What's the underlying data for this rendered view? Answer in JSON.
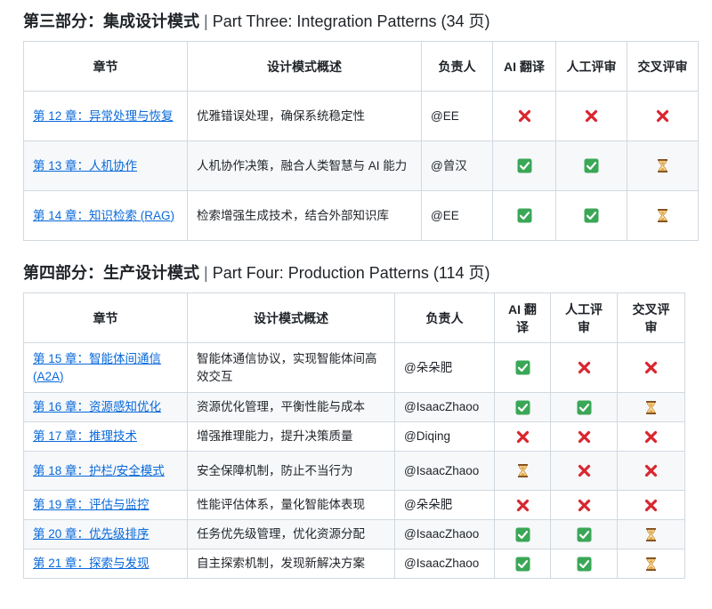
{
  "sections": [
    {
      "title_cn": "第三部分：集成设计模式",
      "sep": "|",
      "title_en": "Part Three: Integration Patterns (34 页)",
      "headers": {
        "chapter": "章节",
        "summary": "设计模式概述",
        "owner": "负责人",
        "ai": "AI 翻译",
        "human": "人工评审",
        "cross": "交叉评审"
      },
      "rows": [
        {
          "chapter": "第 12 章：异常处理与恢复",
          "summary": "优雅错误处理，确保系统稳定性",
          "owner": "@EE",
          "ai": "cross",
          "human": "cross",
          "cross": "cross"
        },
        {
          "chapter": "第 13 章：人机协作",
          "summary": "人机协作决策，融合人类智慧与 AI 能力",
          "owner": "@曾汉",
          "ai": "check",
          "human": "check",
          "cross": "hourglass"
        },
        {
          "chapter": "第 14 章：知识检索 (RAG)",
          "summary": "检索增强生成技术，结合外部知识库",
          "owner": "@EE",
          "ai": "check",
          "human": "check",
          "cross": "hourglass"
        }
      ]
    },
    {
      "title_cn": "第四部分：生产设计模式",
      "sep": "|",
      "title_en": "Part Four: Production Patterns (114 页)",
      "headers": {
        "chapter": "章节",
        "summary": "设计模式概述",
        "owner": "负责人",
        "ai": "AI 翻译",
        "human": "人工评审",
        "cross": "交叉评审"
      },
      "rows": [
        {
          "chapter": "第 15 章：智能体间通信 (A2A)",
          "summary": "智能体通信协议，实现智能体间高效交互",
          "owner": "@朵朵肥",
          "ai": "check",
          "human": "cross",
          "cross": "cross"
        },
        {
          "chapter": "第 16 章：资源感知优化",
          "summary": "资源优化管理，平衡性能与成本",
          "owner": "@IsaacZhaoo",
          "ai": "check",
          "human": "check",
          "cross": "hourglass"
        },
        {
          "chapter": "第 17 章：推理技术",
          "summary": "增强推理能力，提升决策质量",
          "owner": "@Diqing",
          "ai": "cross",
          "human": "cross",
          "cross": "cross"
        },
        {
          "chapter": "第 18 章：护栏/安全模式",
          "summary": "安全保障机制，防止不当行为",
          "owner": "@IsaacZhaoo",
          "ai": "hourglass",
          "human": "cross",
          "cross": "cross"
        },
        {
          "chapter": "第 19 章：评估与监控",
          "summary": "性能评估体系，量化智能体表现",
          "owner": "@朵朵肥",
          "ai": "cross",
          "human": "cross",
          "cross": "cross"
        },
        {
          "chapter": "第 20 章：优先级排序",
          "summary": "任务优先级管理，优化资源分配",
          "owner": "@IsaacZhaoo",
          "ai": "check",
          "human": "check",
          "cross": "hourglass"
        },
        {
          "chapter": "第 21 章：探索与发现",
          "summary": "自主探索机制，发现新解决方案",
          "owner": "@IsaacZhaoo",
          "ai": "check",
          "human": "check",
          "cross": "hourglass"
        }
      ]
    }
  ],
  "colors": {
    "link": "#0969da",
    "check": "#3aa757",
    "cross": "#d9262f",
    "hourglass": "#e0a03a"
  }
}
